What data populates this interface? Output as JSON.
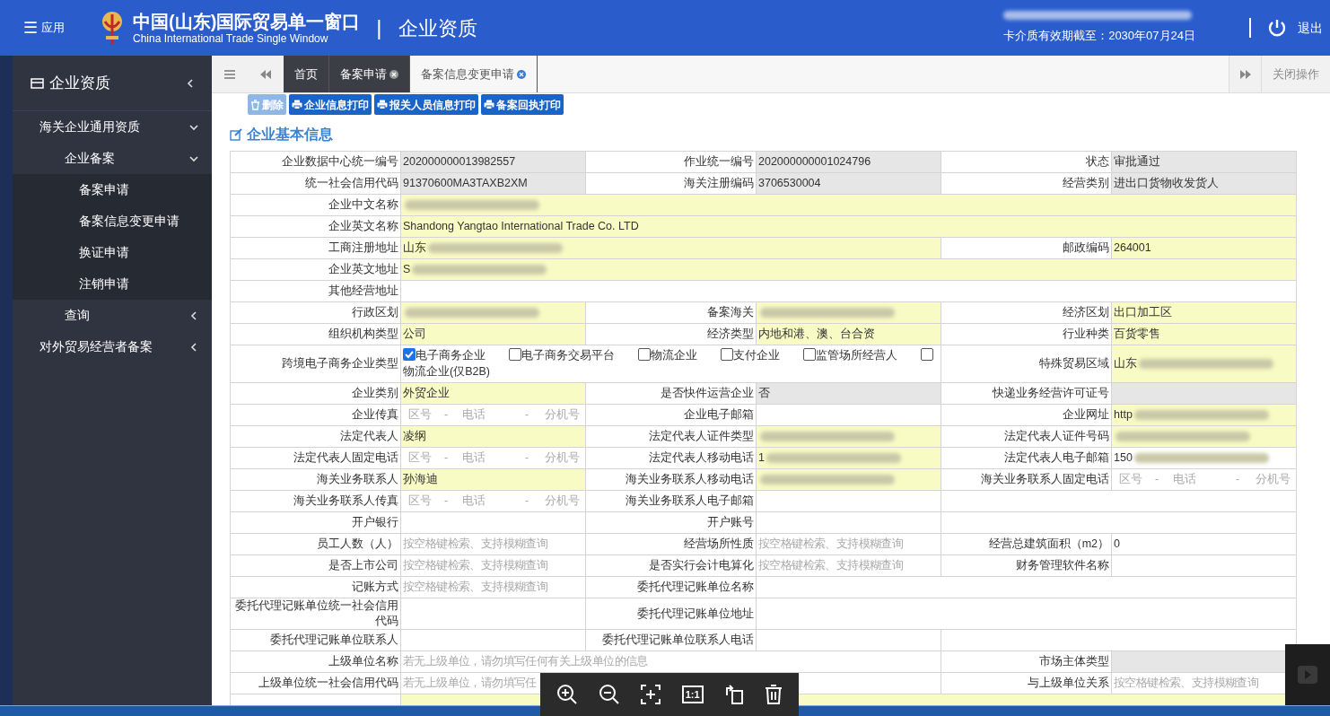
{
  "header": {
    "menu": {
      "icon": "☰",
      "label": "应用"
    },
    "title": "中国(山东)国际贸易单一窗口",
    "subtitle": "China International Trade Single Window",
    "separator": "|",
    "module": "企业资质",
    "account_redacted": true,
    "validity": "卡介质有效期截至：2030年07月24日",
    "logout": "退出"
  },
  "sidebar": {
    "title": "企业资质",
    "items": [
      {
        "label": "海关企业通用资质",
        "expanded": true,
        "children": [
          {
            "label": "企业备案",
            "expanded": true,
            "children": [
              {
                "label": "备案申请"
              },
              {
                "label": "备案信息变更申请"
              },
              {
                "label": "换证申请"
              },
              {
                "label": "注销申请"
              }
            ]
          },
          {
            "label": "查询",
            "expanded": false
          }
        ]
      },
      {
        "label": "对外贸易经营者备案",
        "expanded": false
      }
    ]
  },
  "tabs": [
    {
      "label": "首页",
      "selected": false,
      "closable": false
    },
    {
      "label": "备案申请",
      "selected": false,
      "closable": true
    },
    {
      "label": "备案信息变更申请",
      "selected": true,
      "closable": true
    }
  ],
  "close_ops": "关闭操作",
  "toolbar": [
    {
      "label": "删除",
      "kind": "delete",
      "disabled": true
    },
    {
      "label": "企业信息打印",
      "kind": "print",
      "disabled": false
    },
    {
      "label": "报关人员信息打印",
      "kind": "print",
      "disabled": false
    },
    {
      "label": "备案回执打印",
      "kind": "print",
      "disabled": false
    }
  ],
  "section_title": "企业基本信息",
  "form": {
    "rows": [
      {
        "kind": "triple",
        "fields": [
          {
            "label": "企业数据中心统一编号",
            "kind": "text",
            "value": "202000000013982557",
            "readonly": true
          },
          {
            "label": "作业统一编号",
            "kind": "text",
            "value": "202000000001024796",
            "readonly": true
          },
          {
            "label": "状态",
            "kind": "text",
            "value": "审批通过",
            "readonly": true
          }
        ]
      },
      {
        "kind": "triple",
        "fields": [
          {
            "label": "统一社会信用代码",
            "kind": "text",
            "value": "91370600MA3TAXB2XM",
            "readonly": true
          },
          {
            "label": "海关注册编码",
            "kind": "text",
            "value": "3706530004",
            "readonly": true
          },
          {
            "label": "经营类别",
            "kind": "text",
            "value": "进出口货物收发货人",
            "readonly": true
          }
        ]
      },
      {
        "kind": "full",
        "fields": [
          {
            "label": "企业中文名称",
            "kind": "redacted",
            "readonly": false,
            "required": true
          }
        ]
      },
      {
        "kind": "full",
        "fields": [
          {
            "label": "企业英文名称",
            "kind": "text",
            "value": "Shandong Yangtao International Trade Co. LTD",
            "readonly": false,
            "required": true
          }
        ]
      },
      {
        "kind": "wide_first",
        "fields": [
          {
            "label": "工商注册地址",
            "kind": "redacted",
            "value": "山东",
            "readonly": false,
            "required": true
          },
          {
            "label": "邮政编码",
            "kind": "text",
            "value": "264001",
            "readonly": false,
            "required": true
          }
        ]
      },
      {
        "kind": "full",
        "fields": [
          {
            "label": "企业英文地址",
            "kind": "redacted",
            "value": "S",
            "readonly": false,
            "required": true
          }
        ]
      },
      {
        "kind": "full",
        "fields": [
          {
            "label": "其他经营地址",
            "kind": "text",
            "readonly": false,
            "required": false
          }
        ]
      },
      {
        "kind": "triple",
        "fields": [
          {
            "label": "行政区划",
            "kind": "redacted",
            "readonly": false,
            "required": true
          },
          {
            "label": "备案海关",
            "kind": "redacted",
            "readonly": false,
            "required": true
          },
          {
            "label": "经济区划",
            "kind": "text",
            "value": "出口加工区",
            "readonly": false,
            "required": true
          }
        ]
      },
      {
        "kind": "triple",
        "fields": [
          {
            "label": "组织机构类型",
            "kind": "text",
            "value": "公司",
            "readonly": false,
            "required": true
          },
          {
            "label": "经济类型",
            "kind": "text",
            "value": "内地和港、澳、台合资",
            "readonly": false,
            "required": true
          },
          {
            "label": "行业种类",
            "kind": "text",
            "value": "百货零售",
            "readonly": false,
            "required": true
          }
        ]
      },
      {
        "kind": "wide_first",
        "fields": [
          {
            "label": "跨境电子商务企业类型",
            "kind": "checks",
            "readonly": false,
            "required": false,
            "options": [
              {
                "label": "电子商务企业",
                "checked": true
              },
              {
                "label": "电子商务交易平台",
                "checked": false
              },
              {
                "label": "物流企业",
                "checked": false
              },
              {
                "label": "支付企业",
                "checked": false
              },
              {
                "label": "监管场所经营人",
                "checked": false
              },
              {
                "label": "物流企业(仅B2B)",
                "checked": false
              }
            ]
          },
          {
            "label": "特殊贸易区域",
            "kind": "redacted",
            "value": "山东",
            "readonly": false,
            "required": true
          }
        ]
      },
      {
        "kind": "triple",
        "fields": [
          {
            "label": "企业类别",
            "kind": "text",
            "value": "外贸企业",
            "readonly": false,
            "required": true
          },
          {
            "label": "是否快件运营企业",
            "kind": "text",
            "value": "否",
            "readonly": true
          },
          {
            "label": "快递业务经营许可证号",
            "kind": "text",
            "readonly": true
          }
        ]
      },
      {
        "kind": "triple",
        "fields": [
          {
            "label": "企业传真",
            "kind": "phone",
            "parts": [
              "区号",
              "-",
              "电话",
              "-",
              "分机号"
            ],
            "readonly": false,
            "required": false
          },
          {
            "label": "企业电子邮箱",
            "kind": "text",
            "readonly": false,
            "required": false
          },
          {
            "label": "企业网址",
            "kind": "redacted",
            "value": "http",
            "readonly": false,
            "required": true
          }
        ]
      },
      {
        "kind": "triple",
        "fields": [
          {
            "label": "法定代表人",
            "kind": "text",
            "value": "凌纲",
            "readonly": false,
            "required": true
          },
          {
            "label": "法定代表人证件类型",
            "kind": "redacted",
            "readonly": false,
            "required": true
          },
          {
            "label": "法定代表人证件号码",
            "kind": "redacted",
            "readonly": false,
            "required": true
          }
        ]
      },
      {
        "kind": "triple",
        "fields": [
          {
            "label": "法定代表人固定电话",
            "kind": "phone",
            "parts": [
              "区号",
              "-",
              "电话",
              "-",
              "分机号"
            ],
            "readonly": false,
            "required": false
          },
          {
            "label": "法定代表人移动电话",
            "kind": "redacted",
            "value": "1",
            "readonly": false,
            "required": true
          },
          {
            "label": "法定代表人电子邮箱",
            "kind": "redacted",
            "value": "150",
            "readonly": false,
            "required": false
          }
        ]
      },
      {
        "kind": "triple",
        "fields": [
          {
            "label": "海关业务联系人",
            "kind": "text",
            "value": "孙海迪",
            "readonly": false,
            "required": true
          },
          {
            "label": "海关业务联系人移动电话",
            "kind": "redacted",
            "readonly": false,
            "required": true
          },
          {
            "label": "海关业务联系人固定电话",
            "kind": "phone",
            "parts": [
              "区号",
              "-",
              "电话",
              "-",
              "分机号"
            ],
            "readonly": false,
            "required": false
          }
        ]
      },
      {
        "kind": "pair",
        "fields": [
          {
            "label": "海关业务联系人传真",
            "kind": "phone",
            "parts": [
              "区号",
              "-",
              "电话",
              "-",
              "分机号"
            ],
            "readonly": false,
            "required": false
          },
          {
            "label": "海关业务联系人电子邮箱",
            "kind": "text",
            "readonly": false,
            "required": false
          }
        ]
      },
      {
        "kind": "pair",
        "fields": [
          {
            "label": "开户银行",
            "kind": "text",
            "readonly": false,
            "required": false
          },
          {
            "label": "开户账号",
            "kind": "text",
            "readonly": false,
            "required": false
          }
        ]
      },
      {
        "kind": "triple",
        "fields": [
          {
            "label": "员工人数（人）",
            "kind": "placeholder",
            "placeholder": "按空格键检索、支持模糊查询",
            "readonly": false,
            "required": false
          },
          {
            "label": "经营场所性质",
            "kind": "placeholder",
            "placeholder": "按空格键检索、支持模糊查询",
            "readonly": false,
            "required": false
          },
          {
            "label": "经营总建筑面积（m2）",
            "kind": "text",
            "value": "0",
            "readonly": false,
            "required": false
          }
        ]
      },
      {
        "kind": "triple",
        "fields": [
          {
            "label": "是否上市公司",
            "kind": "placeholder",
            "placeholder": "按空格键检索、支持模糊查询",
            "readonly": false,
            "required": false
          },
          {
            "label": "是否实行会计电算化",
            "kind": "placeholder",
            "placeholder": "按空格键检索、支持模糊查询",
            "readonly": false,
            "required": false
          },
          {
            "label": "财务管理软件名称",
            "kind": "text",
            "readonly": false,
            "required": false
          }
        ]
      },
      {
        "kind": "wide_second",
        "fields": [
          {
            "label": "记账方式",
            "kind": "placeholder",
            "placeholder": "按空格键检索、支持模糊查询",
            "readonly": false,
            "required": false
          },
          {
            "label": "委托代理记账单位名称",
            "kind": "text",
            "readonly": false,
            "required": false
          }
        ]
      },
      {
        "kind": "wide_second",
        "fields": [
          {
            "label": "委托代理记账单位统一社会信用代码",
            "kind": "text",
            "readonly": false,
            "required": false
          },
          {
            "label": "委托代理记账单位地址",
            "kind": "text",
            "readonly": false,
            "required": false
          }
        ]
      },
      {
        "kind": "pair",
        "fields": [
          {
            "label": "委托代理记账单位联系人",
            "kind": "text",
            "readonly": false,
            "required": false
          },
          {
            "label": "委托代理记账单位联系人电话",
            "kind": "text",
            "readonly": false,
            "required": false
          }
        ]
      },
      {
        "kind": "wide_first",
        "fields": [
          {
            "label": "上级单位名称",
            "kind": "placeholder",
            "placeholder": "若无上级单位，请勿填写任何有关上级单位的信息",
            "readonly": false,
            "required": false
          },
          {
            "label": "市场主体类型",
            "kind": "text",
            "readonly": true
          }
        ]
      },
      {
        "kind": "wide_first",
        "fields": [
          {
            "label": "上级单位统一社会信用代码",
            "kind": "placeholder",
            "placeholder": "若无上级单位，请勿填写任",
            "readonly": false,
            "required": false
          },
          {
            "label": "与上级单位关系",
            "kind": "placeholder",
            "placeholder": "按空格键检索、支持模糊查询",
            "readonly": false,
            "required": false
          }
        ]
      }
    ]
  },
  "viewer_toolbar": [
    {
      "kind": "zoom_in"
    },
    {
      "kind": "zoom_out"
    },
    {
      "kind": "fit"
    },
    {
      "kind": "actual_size",
      "label": "1:1"
    },
    {
      "kind": "rotate"
    },
    {
      "kind": "delete"
    }
  ]
}
